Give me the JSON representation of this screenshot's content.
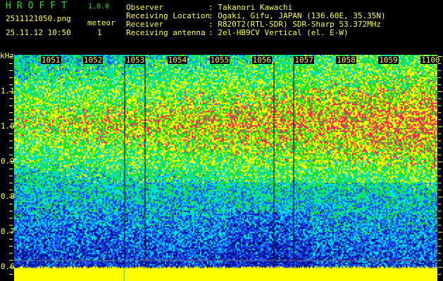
{
  "header": {
    "app_name": "HROFFT",
    "version": "1.0.0",
    "filename": "2511121050.png",
    "datetime": "25.11.12 10:50",
    "meteor_label": "meteor",
    "meteor_count": "1"
  },
  "info": [
    {
      "key": "Observer",
      "value": ": Takanori Kawachi"
    },
    {
      "key": "Receiving Location",
      "value": ": Ogaki, Gifu, JAPAN (136.60E, 35.35N)"
    },
    {
      "key": "Receiver",
      "value": ": R820T2(RTL-SDR) SDR-Sharp 53.372MHz"
    },
    {
      "key": "Receiving antenna",
      "value": ": 2el-HB9CV Vertical (el. E-W)"
    }
  ],
  "spectrogram": {
    "y_unit": "kHz",
    "y_ticks": [
      "1.1",
      "1.0",
      "0.9",
      "0.8",
      "0.7",
      "0.6"
    ],
    "time_labels": [
      "1051",
      "1052",
      "1053",
      "1054",
      "1055",
      "1056",
      "1057",
      "1058",
      "1059",
      "1100"
    ],
    "colors": {
      "high": "#ff2060",
      "mid_high": "#ffff00",
      "mid": "#20e020",
      "low_mid": "#00e0e0",
      "low": "#2050ff",
      "lowest": "#001090",
      "baseline": "#ffff00"
    }
  }
}
